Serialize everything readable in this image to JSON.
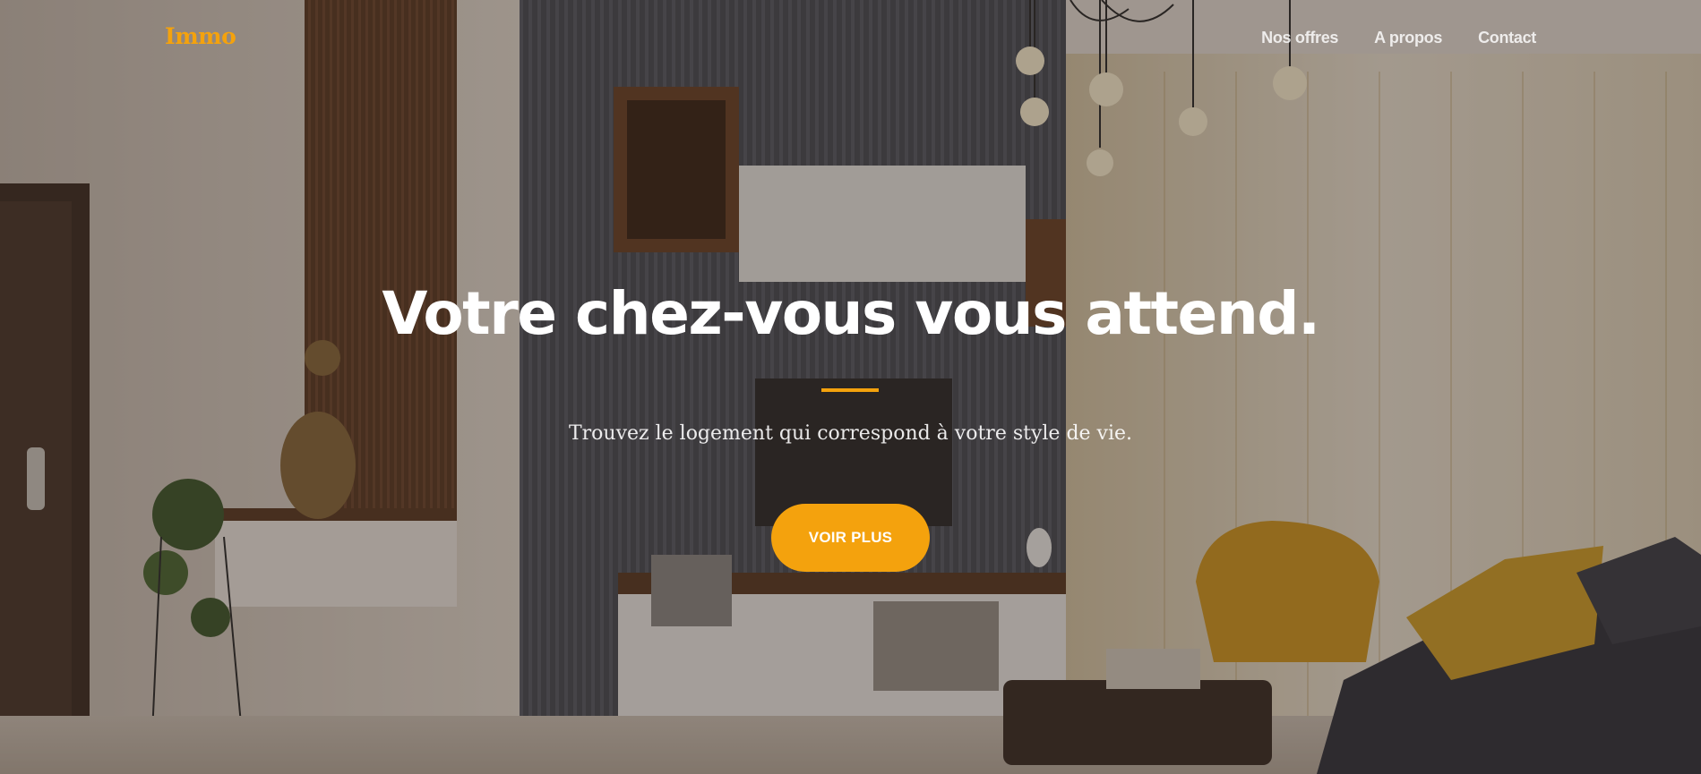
{
  "brand": {
    "name": "Immo",
    "accent_color": "#f4a20d"
  },
  "nav": {
    "items": [
      {
        "label": "Nos offres"
      },
      {
        "label": "A propos"
      },
      {
        "label": "Contact"
      }
    ]
  },
  "hero": {
    "title": "Votre chez-vous vous attend.",
    "subtitle": "Trouvez le logement qui correspond à votre style de vie.",
    "cta_label": "VOIR PLUS",
    "background_image": "living-room-interior"
  }
}
